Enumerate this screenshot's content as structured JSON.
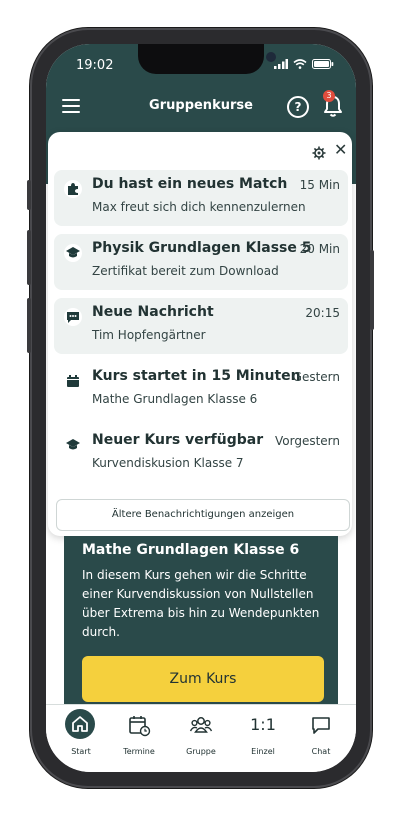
{
  "status": {
    "time": "19:02"
  },
  "appbar": {
    "title": "Gruppenkurse",
    "help": "?",
    "badge_count": "3"
  },
  "notifications": [
    {
      "icon": "puzzle-icon",
      "title": "Du hast ein neues Match",
      "subtitle": "Max freut sich dich kennenzulernen",
      "time": "15 Min",
      "highlight": true
    },
    {
      "icon": "graduation-cap-icon",
      "title": "Physik Grundlagen Klasse 5",
      "subtitle": "Zertifikat bereit zum Download",
      "time": "20 Min",
      "highlight": true
    },
    {
      "icon": "message-icon",
      "title": "Neue Nachricht",
      "subtitle": "Tim Hopfengärtner",
      "time": "20:15",
      "highlight": true
    },
    {
      "icon": "calendar-icon",
      "title": "Kurs startet in 15 Minuten",
      "subtitle": "Mathe Grundlagen Klasse 6",
      "time": "Gestern",
      "highlight": false
    },
    {
      "icon": "graduation-cap-icon",
      "title": "Neuer Kurs verfügbar",
      "subtitle": "Kurvendiskusion Klasse 7",
      "time": "Vorgestern",
      "highlight": false
    }
  ],
  "older_button": "Ältere Benachrichtigungen anzeigen",
  "course": {
    "title": "Mathe Grundlagen Klasse 6",
    "description": "In diesem Kurs gehen wir die Schritte einer Kurvendiskussion von Nullstellen über Extrema bis hin zu Wendepunkten durch.",
    "cta": "Zum Kurs"
  },
  "tabs": [
    {
      "label": "Start",
      "icon": "home-icon",
      "active": true
    },
    {
      "label": "Termine",
      "icon": "calendar-icon",
      "active": false
    },
    {
      "label": "Gruppe",
      "icon": "group-icon",
      "active": false
    },
    {
      "label": "Einzel",
      "icon": "one-to-one-icon",
      "glyph": "1:1",
      "active": false
    },
    {
      "label": "Chat",
      "icon": "chat-icon",
      "active": false
    }
  ],
  "colors": {
    "primary": "#2a4a4a",
    "accent": "#f5d03d",
    "highlight": "#eef2f1",
    "badge": "#e04d3d"
  }
}
